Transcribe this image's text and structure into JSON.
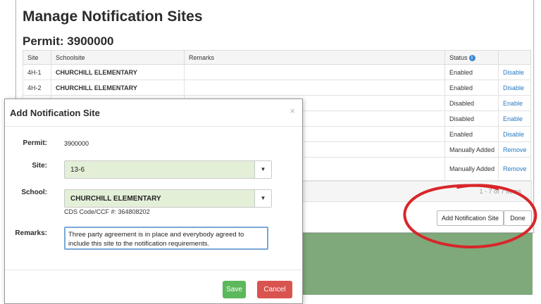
{
  "main": {
    "title": "Manage Notification Sites",
    "permit_heading": "Permit: 3900000",
    "columns": [
      "Site",
      "Schoolsite",
      "Remarks",
      "Status"
    ],
    "rows": [
      {
        "site": "4H-1",
        "school": "CHURCHILL ELEMENTARY",
        "remarks": "",
        "status": "Enabled",
        "action": "Disable"
      },
      {
        "site": "4H-2",
        "school": "CHURCHILL ELEMENTARY",
        "remarks": "",
        "status": "Enabled",
        "action": "Disable"
      },
      {
        "site": "",
        "school": "",
        "remarks": "",
        "status": "Disabled",
        "action": "Enable"
      },
      {
        "site": "",
        "school": "",
        "remarks": "",
        "status": "Disabled",
        "action": "Enable"
      },
      {
        "site": "",
        "school": "",
        "remarks": "",
        "status": "Enabled",
        "action": "Disable"
      },
      {
        "site": "",
        "school": "",
        "remarks": "",
        "status": "Manually Added",
        "action": "Remove"
      },
      {
        "site": "",
        "school": "",
        "remarks": "",
        "status": "Manually Added",
        "action": "Remove"
      }
    ],
    "pager_text": "1 - 7 of 7 items",
    "add_site_button": "Add Notification Site",
    "done_button": "Done"
  },
  "modal": {
    "title": "Add Notification Site",
    "close": "×",
    "permit_label": "Permit:",
    "permit_value": "3900000",
    "site_label": "Site:",
    "site_value": "13-6",
    "school_label": "School:",
    "school_value": "CHURCHILL ELEMENTARY",
    "cds_text": "CDS Code/CCF #: 364808202",
    "remarks_label": "Remarks:",
    "remarks_value": "Three party agreement is in place and everybody agreed to include this site to the notification requirements.",
    "save_button": "Save",
    "cancel_button": "Cancel"
  },
  "colors": {
    "link": "#2a7ac0",
    "save": "#5cb85c",
    "cancel": "#d9534f",
    "select_fill": "#e4efd8",
    "backdrop_green": "#7fa97b",
    "annotation_red": "#d8262a"
  },
  "icons": {
    "status_info": "info-circle-icon",
    "dropdown": "chevron-down-icon",
    "close": "close-icon"
  }
}
